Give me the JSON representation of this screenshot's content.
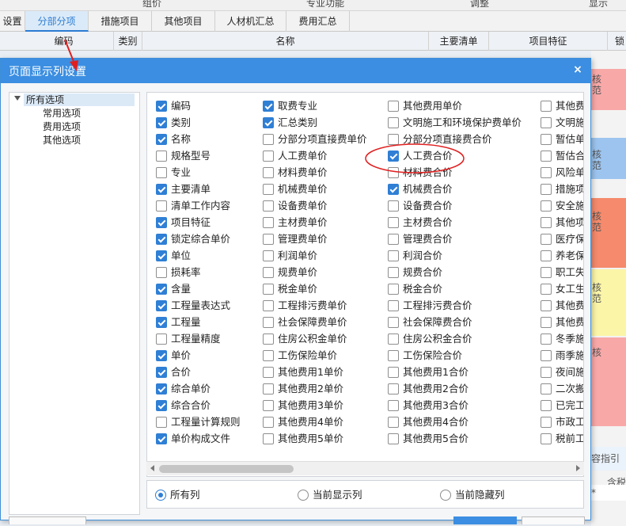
{
  "app": {
    "top_labels": [
      "组价",
      "专业功能",
      "调整",
      "显示"
    ],
    "tabs": [
      {
        "label": "设置",
        "active": false
      },
      {
        "label": "分部分项",
        "active": true
      },
      {
        "label": "措施项目",
        "active": false
      },
      {
        "label": "其他项目",
        "active": false
      },
      {
        "label": "人材机汇总",
        "active": false
      },
      {
        "label": "费用汇总",
        "active": false
      }
    ],
    "columns": [
      "编码",
      "类别",
      "名称",
      "主要清单",
      "项目特征",
      "锁"
    ],
    "side_text": [
      "核",
      "范",
      "核",
      "范",
      "核",
      "范",
      "核",
      "范",
      "核"
    ],
    "side_bottom": [
      "容指引",
      "含税",
      "*"
    ]
  },
  "dialog": {
    "title": "页面显示列设置",
    "close_glyph": "×",
    "tree": {
      "root": "所有选项",
      "children": [
        "常用选项",
        "费用选项",
        "其他选项"
      ]
    },
    "columns_options": [
      [
        {
          "label": "编码",
          "checked": true
        },
        {
          "label": "类别",
          "checked": true
        },
        {
          "label": "名称",
          "checked": true
        },
        {
          "label": "规格型号",
          "checked": false
        },
        {
          "label": "专业",
          "checked": false
        },
        {
          "label": "主要清单",
          "checked": true
        },
        {
          "label": "清单工作内容",
          "checked": false
        },
        {
          "label": "项目特征",
          "checked": true
        },
        {
          "label": "锁定综合单价",
          "checked": true
        },
        {
          "label": "单位",
          "checked": true
        },
        {
          "label": "损耗率",
          "checked": false
        },
        {
          "label": "含量",
          "checked": true
        },
        {
          "label": "工程量表达式",
          "checked": true
        },
        {
          "label": "工程量",
          "checked": true
        },
        {
          "label": "工程量精度",
          "checked": false
        },
        {
          "label": "单价",
          "checked": true
        },
        {
          "label": "合价",
          "checked": true
        },
        {
          "label": "综合单价",
          "checked": true
        },
        {
          "label": "综合合价",
          "checked": true
        },
        {
          "label": "工程量计算规则",
          "checked": false
        },
        {
          "label": "单价构成文件",
          "checked": true
        }
      ],
      [
        {
          "label": "取费专业",
          "checked": true
        },
        {
          "label": "汇总类别",
          "checked": true
        },
        {
          "label": "分部分项直接费单价",
          "checked": false
        },
        {
          "label": "人工费单价",
          "checked": false
        },
        {
          "label": "材料费单价",
          "checked": false
        },
        {
          "label": "机械费单价",
          "checked": false
        },
        {
          "label": "设备费单价",
          "checked": false
        },
        {
          "label": "主材费单价",
          "checked": false
        },
        {
          "label": "管理费单价",
          "checked": false
        },
        {
          "label": "利润单价",
          "checked": false
        },
        {
          "label": "规费单价",
          "checked": false
        },
        {
          "label": "税金单价",
          "checked": false
        },
        {
          "label": "工程排污费单价",
          "checked": false
        },
        {
          "label": "社会保障费单价",
          "checked": false
        },
        {
          "label": "住房公积金单价",
          "checked": false
        },
        {
          "label": "工伤保险单价",
          "checked": false
        },
        {
          "label": "其他费用1单价",
          "checked": false
        },
        {
          "label": "其他费用2单价",
          "checked": false
        },
        {
          "label": "其他费用3单价",
          "checked": false
        },
        {
          "label": "其他费用4单价",
          "checked": false
        },
        {
          "label": "其他费用5单价",
          "checked": false
        }
      ],
      [
        {
          "label": "其他费用单价",
          "checked": false
        },
        {
          "label": "文明施工和环境保护费单价",
          "checked": false
        },
        {
          "label": "分部分项直接费合价",
          "checked": false
        },
        {
          "label": "人工费合价",
          "checked": true
        },
        {
          "label": "材料费合价",
          "checked": false
        },
        {
          "label": "机械费合价",
          "checked": true
        },
        {
          "label": "设备费合价",
          "checked": false
        },
        {
          "label": "主材费合价",
          "checked": false
        },
        {
          "label": "管理费合价",
          "checked": false
        },
        {
          "label": "利润合价",
          "checked": false
        },
        {
          "label": "规费合价",
          "checked": false
        },
        {
          "label": "税金合价",
          "checked": false
        },
        {
          "label": "工程排污费合价",
          "checked": false
        },
        {
          "label": "社会保障费合价",
          "checked": false
        },
        {
          "label": "住房公积金合价",
          "checked": false
        },
        {
          "label": "工伤保险合价",
          "checked": false
        },
        {
          "label": "其他费用1合价",
          "checked": false
        },
        {
          "label": "其他费用2合价",
          "checked": false
        },
        {
          "label": "其他费用3合价",
          "checked": false
        },
        {
          "label": "其他费用4合价",
          "checked": false
        },
        {
          "label": "其他费用5合价",
          "checked": false
        }
      ],
      [
        {
          "label": "其他费",
          "checked": false
        },
        {
          "label": "文明施",
          "checked": false
        },
        {
          "label": "暂估单",
          "checked": false
        },
        {
          "label": "暂估合",
          "checked": false
        },
        {
          "label": "风险单",
          "checked": false
        },
        {
          "label": "措施项",
          "checked": false
        },
        {
          "label": "安全施",
          "checked": false
        },
        {
          "label": "其他项",
          "checked": false
        },
        {
          "label": "医疗保",
          "checked": false
        },
        {
          "label": "养老保",
          "checked": false
        },
        {
          "label": "职工失",
          "checked": false
        },
        {
          "label": "女工生",
          "checked": false
        },
        {
          "label": "其他费",
          "checked": false
        },
        {
          "label": "其他费",
          "checked": false
        },
        {
          "label": "冬季施",
          "checked": false
        },
        {
          "label": "雨季施",
          "checked": false
        },
        {
          "label": "夜间施",
          "checked": false
        },
        {
          "label": "二次搬",
          "checked": false
        },
        {
          "label": "已完工",
          "checked": false
        },
        {
          "label": "市政工",
          "checked": false
        },
        {
          "label": "税前工",
          "checked": false
        }
      ]
    ],
    "radio_options": [
      {
        "label": "所有列",
        "selected": true
      },
      {
        "label": "当前显示列",
        "selected": false
      },
      {
        "label": "当前隐藏列",
        "selected": false
      }
    ]
  },
  "colors": {
    "accent": "#3b8ee1",
    "check": "#2f7fd5",
    "annotation_red": "#e02020",
    "row_pink": "#f9a8a8",
    "row_blue": "#9cc4ef",
    "row_yellow": "#fbf5a8",
    "row_orange": "#f58a6c"
  }
}
